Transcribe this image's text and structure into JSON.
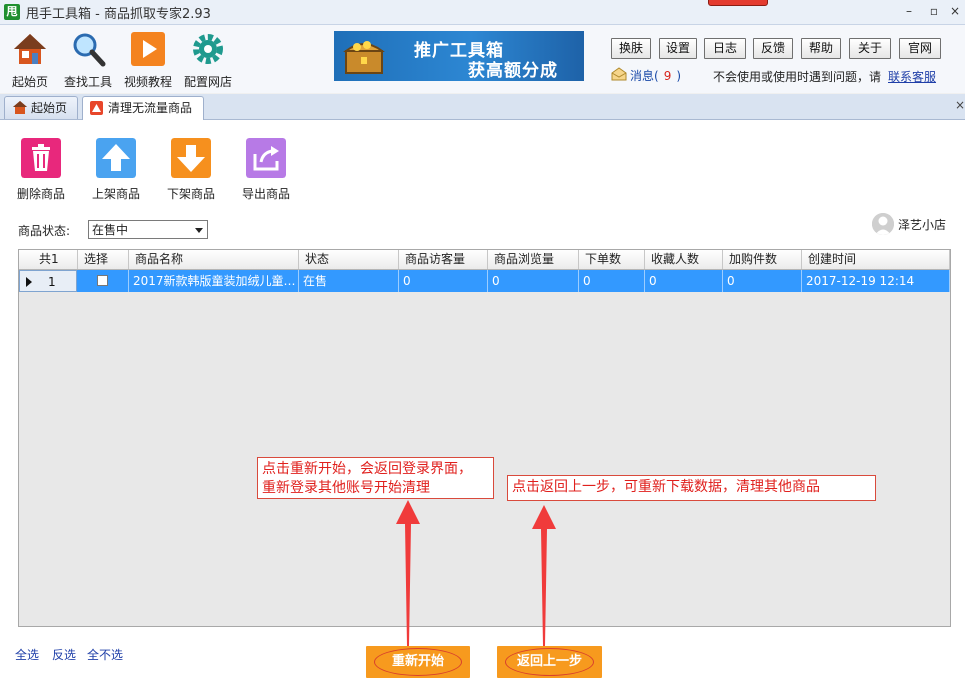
{
  "window": {
    "logo_text": "甩",
    "title": "甩手工具箱 - 商品抓取专家2.93",
    "minimize": "–",
    "maximize": "▫",
    "close": "×"
  },
  "toolbar": {
    "items": [
      {
        "label": "起始页",
        "icon": "house-icon"
      },
      {
        "label": "查找工具",
        "icon": "magnifier-icon"
      },
      {
        "label": "视频教程",
        "icon": "play-icon"
      },
      {
        "label": "配置网店",
        "icon": "gear-icon"
      }
    ]
  },
  "promo": {
    "line1": "推广工具箱",
    "line2": "获高额分成"
  },
  "top_buttons": [
    "换肤",
    "设置",
    "日志",
    "反馈",
    "帮助",
    "关于",
    "官网"
  ],
  "messages": {
    "label": "消息(",
    "count": "9",
    "suffix": ")"
  },
  "help": {
    "text": "不会使用或使用时遇到问题，请",
    "link": "联系客服"
  },
  "tabs": [
    {
      "label": "起始页",
      "active": false
    },
    {
      "label": "清理无流量商品",
      "active": true
    }
  ],
  "tab_close": "×",
  "actions": [
    {
      "label": "删除商品",
      "color": "#e8287c",
      "icon": "trash-icon"
    },
    {
      "label": "上架商品",
      "color": "#4aa3f0",
      "icon": "arrow-up-icon"
    },
    {
      "label": "下架商品",
      "color": "#f6901e",
      "icon": "arrow-down-icon"
    },
    {
      "label": "导出商品",
      "color": "#b77ae6",
      "icon": "export-icon"
    }
  ],
  "filter": {
    "label": "商品状态:",
    "selected": "在售中"
  },
  "shop": {
    "name": "泽艺小店"
  },
  "grid": {
    "columns": [
      "共1",
      "选择",
      "商品名称",
      "状态",
      "商品访客量",
      "商品浏览量",
      "下单数",
      "收藏人数",
      "加购件数",
      "创建时间"
    ],
    "rows": [
      {
        "index": "1",
        "checked": false,
        "name": "2017新款韩版童装加绒儿童…",
        "status": "在售",
        "visitors": "0",
        "views": "0",
        "orders": "0",
        "favorites": "0",
        "cart": "0",
        "created": "2017-12-19 12:14"
      }
    ],
    "selected_color": "#3399ff"
  },
  "annotations": {
    "restart_line1": "点击重新开始，会返回登录界面，",
    "restart_line2": "重新登录其他账号开始清理",
    "back": "点击返回上一步，可重新下载数据，清理其他商品",
    "color": "#e0201d"
  },
  "footer": {
    "select_all": "全选",
    "invert": "反选",
    "select_none": "全不选",
    "restart_button": "重新开始",
    "back_button": "返回上一步"
  }
}
